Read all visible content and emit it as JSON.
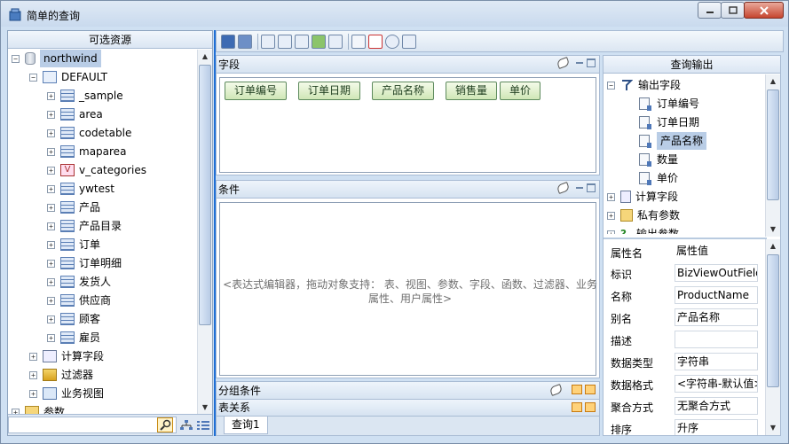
{
  "window": {
    "title": "简单的查询",
    "controls": [
      "minimize",
      "maximize",
      "close"
    ]
  },
  "left_panel": {
    "title": "可选资源",
    "tree": [
      {
        "label": "northwind",
        "icon": "database-icon",
        "expanded": true,
        "selected": true
      },
      {
        "label": "DEFAULT",
        "icon": "schema-icon",
        "expanded": true
      },
      {
        "label": "_sample",
        "icon": "table-icon"
      },
      {
        "label": "area",
        "icon": "table-icon"
      },
      {
        "label": "codetable",
        "icon": "table-icon"
      },
      {
        "label": "maparea",
        "icon": "table-icon"
      },
      {
        "label": "v_categories",
        "icon": "view-icon"
      },
      {
        "label": "ywtest",
        "icon": "table-icon"
      },
      {
        "label": "产品",
        "icon": "table-icon"
      },
      {
        "label": "产品目录",
        "icon": "table-icon"
      },
      {
        "label": "订单",
        "icon": "table-icon"
      },
      {
        "label": "订单明细",
        "icon": "table-icon"
      },
      {
        "label": "发货人",
        "icon": "table-icon"
      },
      {
        "label": "供应商",
        "icon": "table-icon"
      },
      {
        "label": "顾客",
        "icon": "table-icon"
      },
      {
        "label": "雇员",
        "icon": "table-icon"
      },
      {
        "label": "计算字段",
        "icon": "calc-field-icon"
      },
      {
        "label": "过滤器",
        "icon": "filter-icon"
      },
      {
        "label": "业务视图",
        "icon": "bizview-icon"
      },
      {
        "label": "参数",
        "icon": "param-icon"
      }
    ]
  },
  "center": {
    "fields": {
      "title": "字段",
      "items": [
        "订单编号",
        "订单日期",
        "产品名称",
        "销售量",
        "单价"
      ]
    },
    "conditions": {
      "title": "条件",
      "hint_line1": "<表达式编辑器，拖动对象支持：    表、视图、参数、字段、函数、过滤器、业务",
      "hint_line2": "属性、用户属性>"
    },
    "group_conditions": {
      "title": "分组条件"
    },
    "table_relations": {
      "title": "表关系"
    },
    "tabs": [
      "查询1"
    ]
  },
  "right_panel": {
    "title": "查询输出",
    "output_tree": [
      {
        "label": "输出字段",
        "icon": "output-fields-icon",
        "expanded": true
      },
      {
        "label": "订单编号",
        "icon": "field-icon"
      },
      {
        "label": "订单日期",
        "icon": "field-icon"
      },
      {
        "label": "产品名称",
        "icon": "field-icon",
        "selected": true
      },
      {
        "label": "数量",
        "icon": "field-icon"
      },
      {
        "label": "单价",
        "icon": "field-icon"
      },
      {
        "label": "计算字段",
        "icon": "calc-field-icon"
      },
      {
        "label": "私有参数",
        "icon": "param-icon"
      },
      {
        "label": "输出参数",
        "icon": "help-icon"
      }
    ],
    "properties": {
      "header": {
        "name": "属性名",
        "value": "属性值"
      },
      "rows": [
        {
          "name": "标识",
          "value": "BizViewOutField"
        },
        {
          "name": "名称",
          "value": "ProductName"
        },
        {
          "name": "别名",
          "value": "产品名称"
        },
        {
          "name": "描述",
          "value": ""
        },
        {
          "name": "数据类型",
          "value": "字符串"
        },
        {
          "name": "数据格式",
          "value": "<字符串-默认值>"
        },
        {
          "name": "聚合方式",
          "value": "无聚合方式"
        },
        {
          "name": "排序",
          "value": "升序"
        }
      ]
    }
  },
  "colors": {
    "accent": "#1e6fd6",
    "chip_bg": "#cfe6b6",
    "frame": "#cfe0f2"
  }
}
